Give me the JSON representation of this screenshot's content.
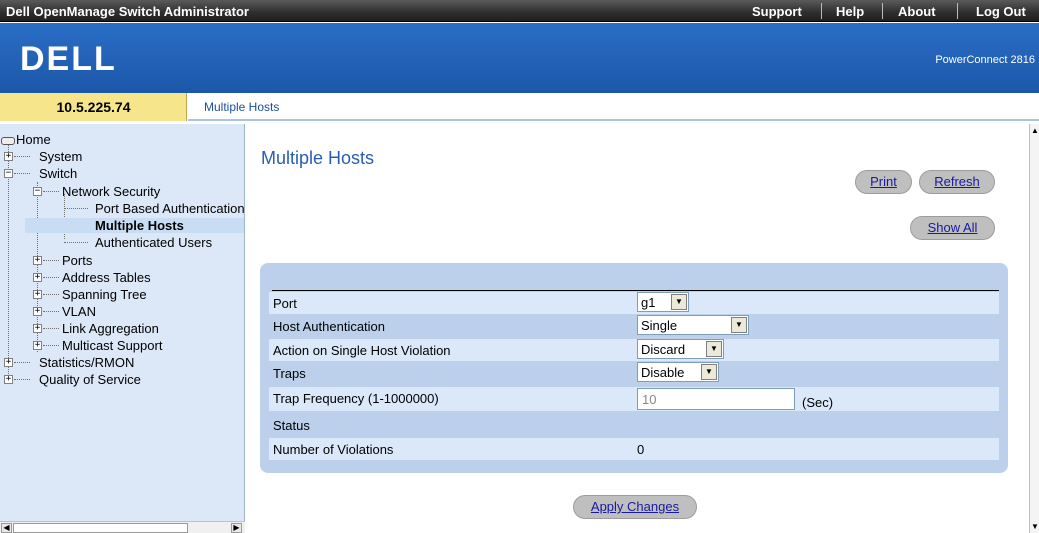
{
  "app": {
    "title": "Dell OpenManage Switch Administrator",
    "links": [
      "Support",
      "Help",
      "About",
      "Log Out"
    ]
  },
  "banner": {
    "logo": "DELL",
    "product": "PowerConnect 2816"
  },
  "context": {
    "ip": "10.5.225.74",
    "breadcrumb": "Multiple Hosts"
  },
  "tree": {
    "items": [
      {
        "label": "Home"
      },
      {
        "label": "System"
      },
      {
        "label": "Switch"
      },
      {
        "label": "Network Security"
      },
      {
        "label": "Port Based Authentication"
      },
      {
        "label": "Multiple Hosts"
      },
      {
        "label": "Authenticated Users"
      },
      {
        "label": "Ports"
      },
      {
        "label": "Address Tables"
      },
      {
        "label": "Spanning Tree"
      },
      {
        "label": "VLAN"
      },
      {
        "label": "Link Aggregation"
      },
      {
        "label": "Multicast Support"
      },
      {
        "label": "Statistics/RMON"
      },
      {
        "label": "Quality of Service"
      }
    ]
  },
  "page": {
    "title": "Multiple Hosts",
    "buttons": {
      "print": "Print",
      "refresh": "Refresh",
      "show_all": "Show All",
      "apply": "Apply Changes"
    }
  },
  "form": {
    "port": {
      "label": "Port",
      "value": "g1"
    },
    "host_auth": {
      "label": "Host Authentication",
      "value": "Single"
    },
    "violation_action": {
      "label": "Action on Single Host Violation",
      "value": "Discard"
    },
    "traps": {
      "label": "Traps",
      "value": "Disable"
    },
    "trap_freq": {
      "label": "Trap Frequency (1-1000000)",
      "value": "10",
      "unit": "(Sec)"
    },
    "status": {
      "label": "Status"
    },
    "violations": {
      "label": "Number of Violations",
      "value": "0"
    }
  }
}
